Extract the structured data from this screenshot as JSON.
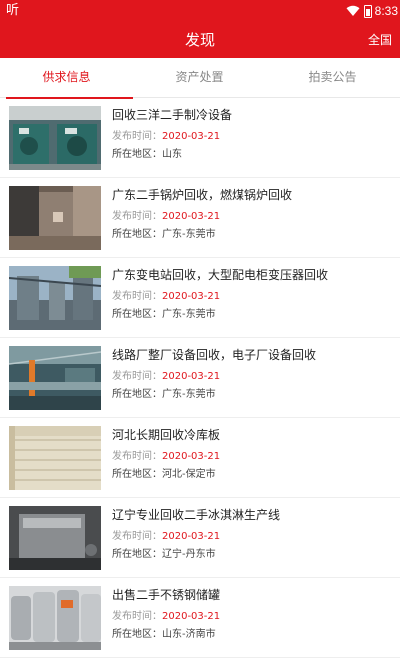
{
  "status_bar": {
    "app_icon": "听",
    "time": "8:33",
    "icons": [
      "wifi-icon",
      "battery-icon"
    ]
  },
  "header": {
    "title": "发现",
    "region_label": "全国",
    "background_color": "#e0161d"
  },
  "tabs": [
    {
      "label": "供求信息",
      "active": true
    },
    {
      "label": "资产处置",
      "active": false
    },
    {
      "label": "拍卖公告",
      "active": false
    }
  ],
  "labels": {
    "publish_time": "发布时间：",
    "location": "所在地区："
  },
  "items": [
    {
      "title": "回收三洋二手制冷设备",
      "date": "2020-03-21",
      "location": "山东"
    },
    {
      "title": "广东二手锅炉回收，燃煤锅炉回收",
      "date": "2020-03-21",
      "location": "广东-东莞市"
    },
    {
      "title": "广东变电站回收，大型配电柜变压器回收",
      "date": "2020-03-21",
      "location": "广东-东莞市"
    },
    {
      "title": "线路厂整厂设备回收，电子厂设备回收",
      "date": "2020-03-21",
      "location": "广东-东莞市"
    },
    {
      "title": "河北长期回收冷库板",
      "date": "2020-03-21",
      "location": "河北-保定市"
    },
    {
      "title": "辽宁专业回收二手冰淇淋生产线",
      "date": "2020-03-21",
      "location": "辽宁-丹东市"
    },
    {
      "title": "出售二手不锈钢储罐",
      "date": "2020-03-21",
      "location": "山东-济南市"
    }
  ],
  "colors": {
    "accent": "#e0161d",
    "date_text": "#e0161d",
    "muted_text": "#999999"
  }
}
